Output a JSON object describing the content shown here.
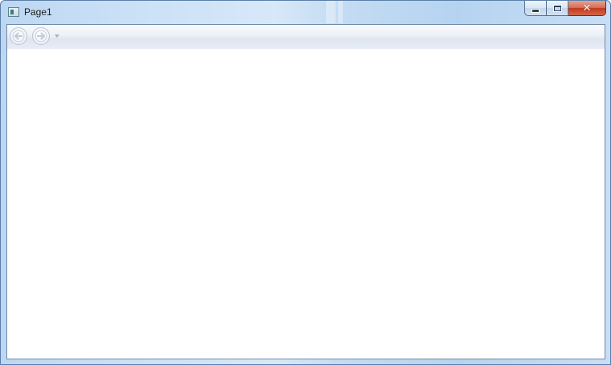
{
  "window": {
    "title": "Page1",
    "caption_buttons": {
      "minimize_icon": "minimize-icon",
      "maximize_icon": "maximize-icon",
      "close_glyph": "✕"
    }
  },
  "navigation": {
    "back_icon": "arrow-left-icon",
    "forward_icon": "arrow-right-icon",
    "history_icon": "chevron-down-icon"
  },
  "colors": {
    "frame": "#c4dcf3",
    "close_button": "#c2381a",
    "nav_bar": "#e8ecf7",
    "content": "#ffffff"
  }
}
